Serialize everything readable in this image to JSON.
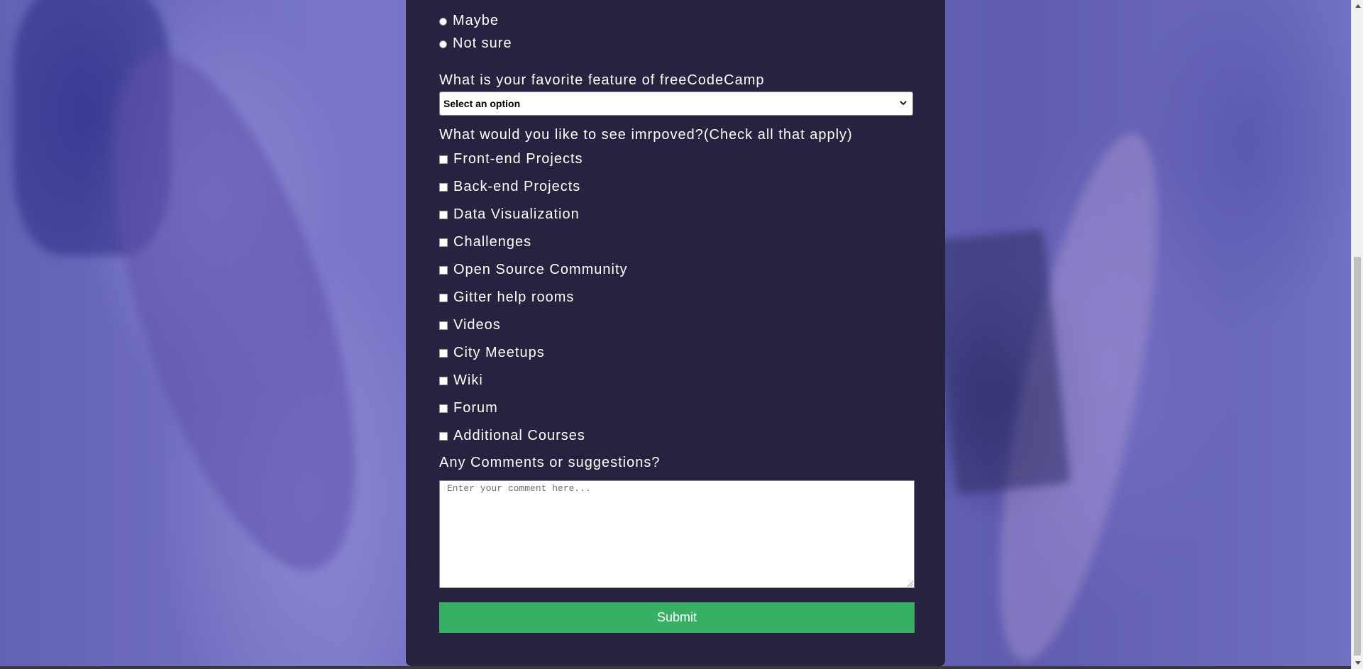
{
  "survey": {
    "radio_options": [
      "Maybe",
      "Not sure"
    ],
    "favorite_feature_label": "What is your favorite feature of freeCodeCamp",
    "favorite_feature_selected": "Select an option",
    "improve_label": "What would you like to see imrpoved?(Check all that apply)",
    "improve_options": [
      "Front-end Projects",
      "Back-end Projects",
      "Data Visualization",
      "Challenges",
      "Open Source Community",
      "Gitter help rooms",
      "Videos",
      "City Meetups",
      "Wiki",
      "Forum",
      "Additional Courses"
    ],
    "comments_label": "Any Comments or suggestions?",
    "comments_placeholder": "Enter your comment here...",
    "submit_label": "Submit"
  },
  "icons": {
    "select_chevron": "chevron-down-icon",
    "scroll_up": "triangle-up-icon",
    "scroll_down": "triangle-down-icon"
  },
  "colors": {
    "panel_background": "#25233f",
    "submit_button": "#37af64",
    "page_tint": "#6a67b8"
  }
}
